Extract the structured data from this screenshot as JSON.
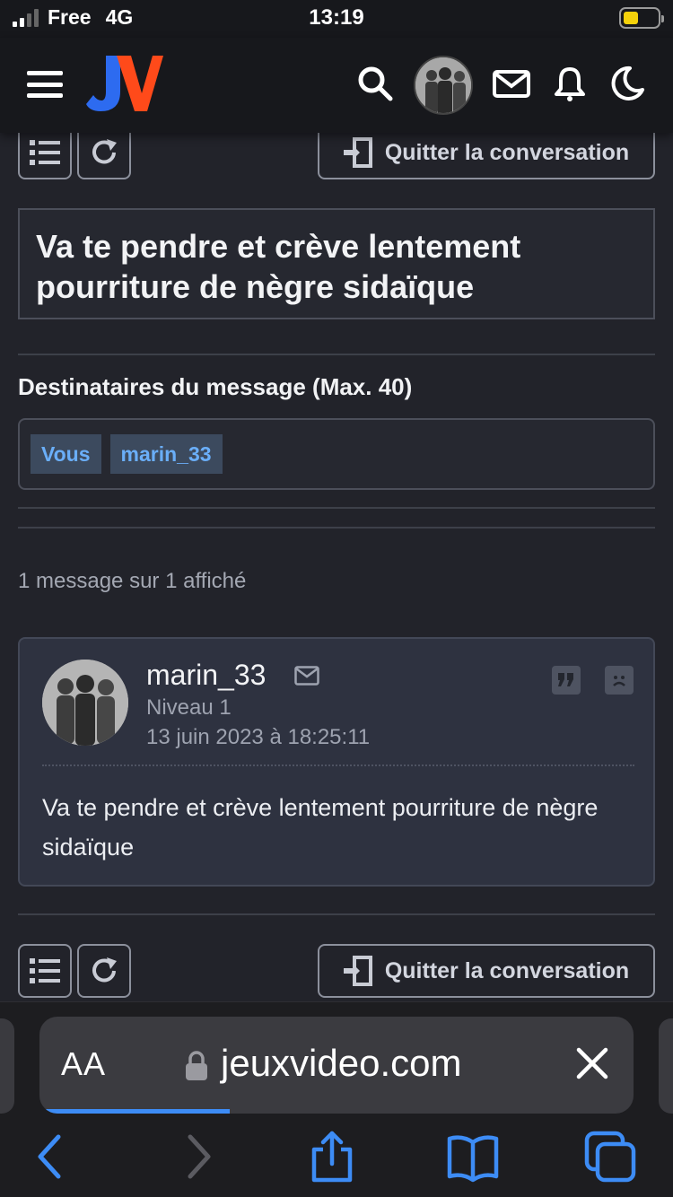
{
  "status_bar": {
    "carrier": "Free",
    "network": "4G",
    "time": "13:19",
    "battery_level": 0.45,
    "battery_color": "#f5d20b"
  },
  "header": {
    "logo_text": "JV",
    "logo_colors": {
      "j": "#2d6bf0",
      "v": "#ff4a1a"
    },
    "icons": [
      "menu-icon",
      "search-icon",
      "avatar",
      "mail-icon",
      "bell-icon",
      "moon-icon"
    ]
  },
  "toolbar": {
    "quit_label": "Quitter la conversation"
  },
  "conversation": {
    "title": "Va te pendre et crève lentement pourriture de nègre sidaïque",
    "recipients_label": "Destinataires du message (Max. 40)",
    "recipients": [
      "Vous",
      "marin_33"
    ],
    "count_text": "1 message sur 1 affiché"
  },
  "message": {
    "author": "marin_33",
    "level": "Niveau 1",
    "date": "13 juin 2023 à 18:25:11",
    "body": "Va te pendre et crève lentement pourriture de nègre sidaïque"
  },
  "browser": {
    "aa_label": "AA",
    "url": "jeuxvideo.com",
    "load_progress": 0.32,
    "accent_color": "#3d8cf5"
  }
}
